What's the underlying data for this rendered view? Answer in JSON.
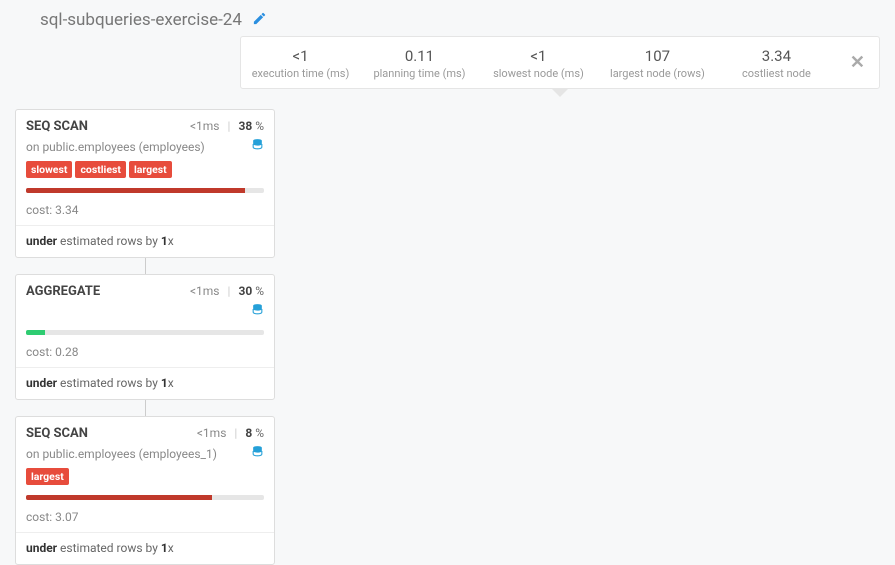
{
  "header": {
    "title": "sql-subqueries-exercise-24"
  },
  "stats": [
    {
      "value": "<1",
      "label": "execution time (ms)"
    },
    {
      "value": "0.11",
      "label": "planning time (ms)"
    },
    {
      "value": "<1",
      "label": "slowest node (ms)"
    },
    {
      "value": "107",
      "label": "largest node (rows)"
    },
    {
      "value": "3.34",
      "label": "costliest node"
    }
  ],
  "nodes": [
    {
      "title": "SEQ SCAN",
      "time": "<1ms",
      "pct": "38",
      "pct_suffix": "%",
      "subtitle": "on public.employees (employees)",
      "tags": [
        "slowest",
        "costliest",
        "largest"
      ],
      "bar_width": "92%",
      "bar_color": "bar-red",
      "cost_label": "cost:",
      "cost": "3.34",
      "est_prefix": "under",
      "est_mid": " estimated rows by ",
      "est_val": "1",
      "est_suffix": "x"
    },
    {
      "title": "AGGREGATE",
      "time": "<1ms",
      "pct": "30",
      "pct_suffix": "%",
      "subtitle": "",
      "tags": [],
      "bar_width": "8%",
      "bar_color": "bar-green",
      "cost_label": "cost:",
      "cost": "0.28",
      "est_prefix": "under",
      "est_mid": " estimated rows by ",
      "est_val": "1",
      "est_suffix": "x"
    },
    {
      "title": "SEQ SCAN",
      "time": "<1ms",
      "pct": "8",
      "pct_suffix": "%",
      "subtitle": "on public.employees (employees_1)",
      "tags": [
        "largest"
      ],
      "bar_width": "78%",
      "bar_color": "bar-red",
      "cost_label": "cost:",
      "cost": "3.07",
      "est_prefix": "under",
      "est_mid": " estimated rows by ",
      "est_val": "1",
      "est_suffix": "x"
    }
  ]
}
